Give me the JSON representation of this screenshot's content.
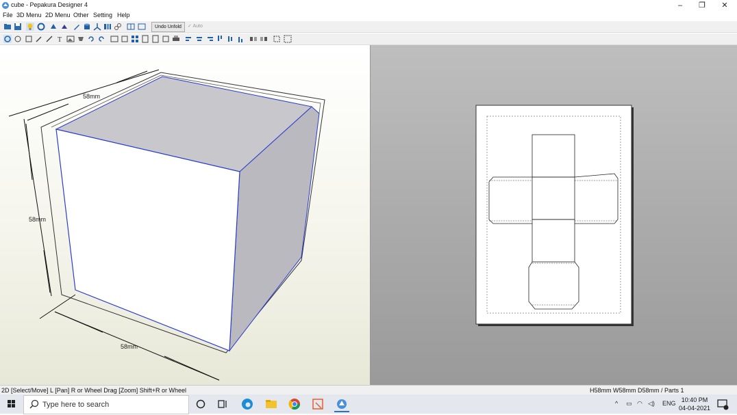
{
  "window": {
    "title": "cube - Pepakura Designer 4",
    "minimize": "–",
    "maximize": "❐",
    "close": "✕"
  },
  "menu": [
    {
      "label": "File"
    },
    {
      "label": "3D Menu"
    },
    {
      "label": "2D Menu"
    },
    {
      "label": "Other"
    },
    {
      "label": "Setting"
    },
    {
      "label": "Help"
    }
  ],
  "toolbar": {
    "undo_unfold": "Undo Unfold",
    "auto": "Auto"
  },
  "view3d": {
    "dim_top": "58mm",
    "dim_left": "58mm",
    "dim_bottom": "58mm"
  },
  "status": {
    "left": "2D [Select/Move] L [Pan] R or Wheel Drag [Zoom] Shift+R or Wheel",
    "right": "H58mm W58mm D58mm / Parts 1"
  },
  "taskbar": {
    "search_placeholder": "Type here to search",
    "language": "ENG",
    "time": "10:40 PM",
    "date": "04-04-2021"
  },
  "colors": {
    "accent": "#2a3ccf",
    "view2d_bg": "#a8a8a8",
    "taskbar": "#e4e8ee"
  }
}
